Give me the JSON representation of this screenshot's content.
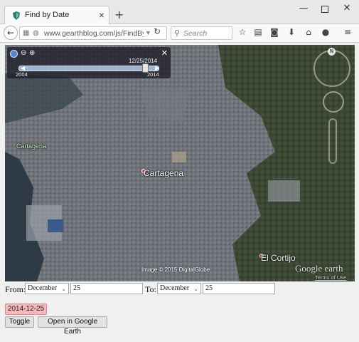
{
  "browser": {
    "tab_title": "Find by Date",
    "new_tab": "+",
    "url": "www.gearthblog.com/js/FindBy",
    "search_placeholder": "Search"
  },
  "map": {
    "timeslider": {
      "current_date": "12/25/2014",
      "start_year": "2004",
      "end_year": "2014"
    },
    "labels": {
      "city_main": "Cartagena",
      "city_small": "Cartagena",
      "place_2": "El Cortijo"
    },
    "imagery_credit": "Image © 2015 DigitalGlobe",
    "logo_text": "Google earth",
    "terms": "Terms of Use",
    "compass_letter": "N",
    "colors": {
      "water": "#2f3d4a",
      "urban": "#6f737a",
      "vegetation": "#3d4a34"
    }
  },
  "form": {
    "from_label": "From:",
    "from_month": "December",
    "from_day": "25",
    "to_label": "To:",
    "to_month": "December",
    "to_day": "25",
    "result_date": "2014-12-25",
    "toggle_label": "Toggle",
    "open_label": "Open in Google Earth"
  }
}
